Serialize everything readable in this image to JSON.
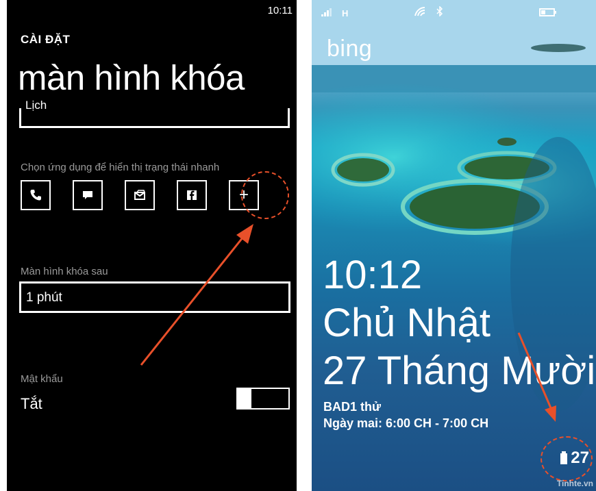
{
  "settings": {
    "status_time": "10:11",
    "section": "CÀI ĐẶT",
    "title": "màn hình khóa",
    "cut_field_text": "Lịch",
    "quick_status_label": "Chọn ứng dụng để hiển thị trạng thái nhanh",
    "apps": [
      {
        "name": "phone-icon"
      },
      {
        "name": "messaging-icon"
      },
      {
        "name": "mail-icon"
      },
      {
        "name": "facebook-icon"
      },
      {
        "name": "add-icon"
      }
    ],
    "lock_after_label": "Màn hình khóa sau",
    "lock_after_value": "1 phút",
    "password_label": "Mật khẩu",
    "password_value": "Tắt"
  },
  "lockscreen": {
    "network": "H",
    "brand": "bing",
    "time": "10:12",
    "day": "Chủ Nhật",
    "date": "27 Tháng Mười",
    "event_title": "BAD1 thử",
    "event_detail": "Ngày mai: 6:00 CH - 7:00 CH",
    "battery": "27",
    "watermark": "Tinhte.vn"
  },
  "colors": {
    "annotation": "#e8502a"
  }
}
